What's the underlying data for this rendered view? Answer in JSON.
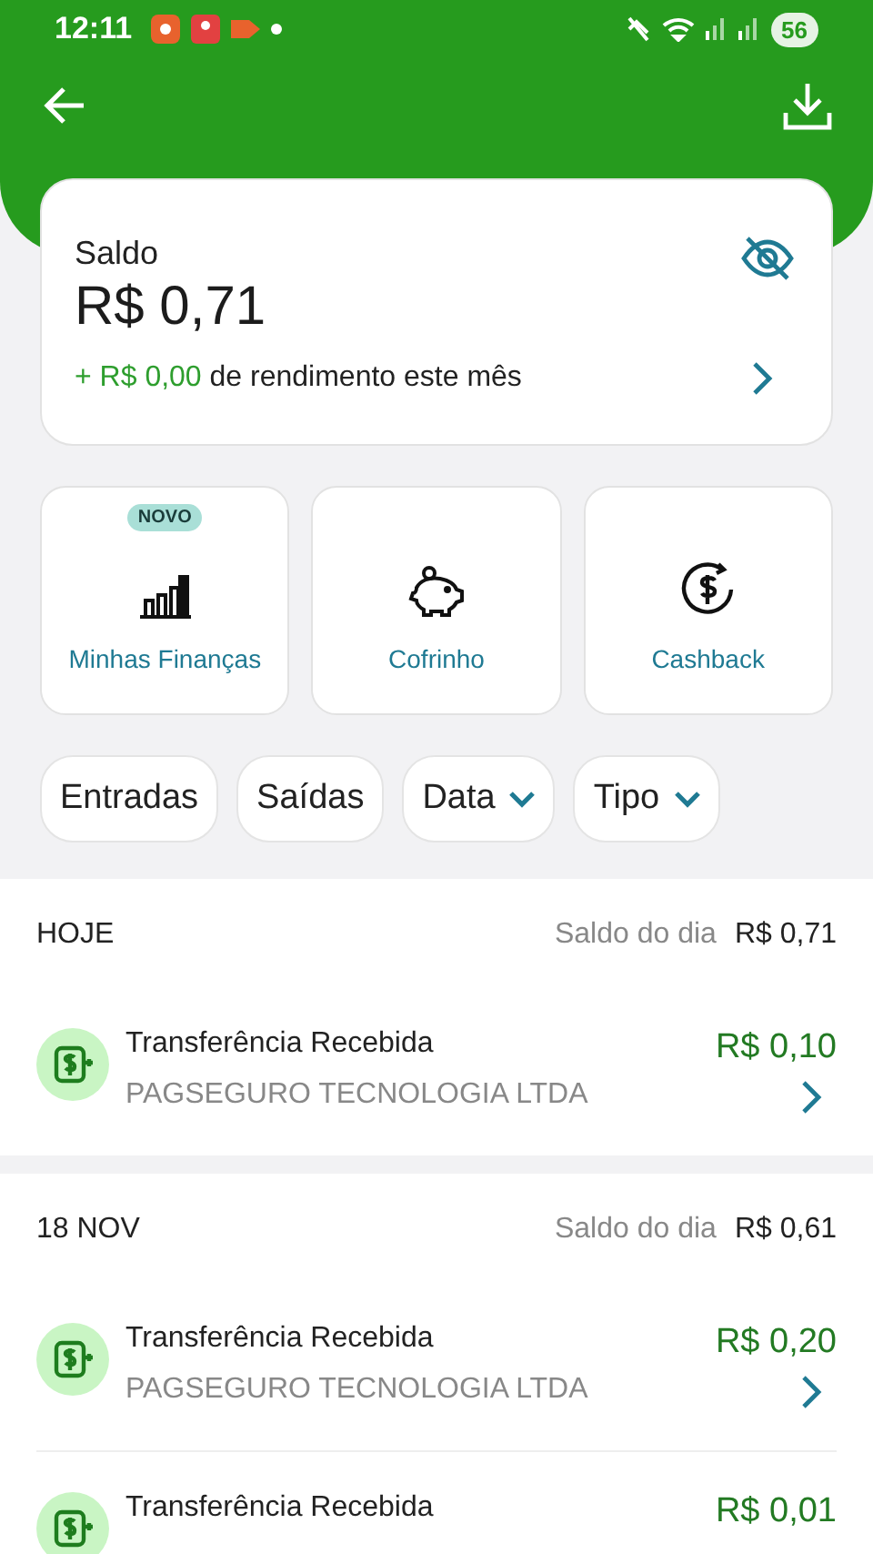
{
  "status_bar": {
    "time": "12:11",
    "battery": "56"
  },
  "balance": {
    "label": "Saldo",
    "amount": "R$ 0,71",
    "yield_amount": "+ R$ 0,00",
    "yield_text": "de rendimento este mês",
    "hidden": false
  },
  "shortcuts": [
    {
      "kind": "chart",
      "label": "Minhas Finanças",
      "badge": "NOVO"
    },
    {
      "kind": "piggy",
      "label": "Cofrinho"
    },
    {
      "kind": "cashback",
      "label": "Cashback"
    }
  ],
  "filters": [
    {
      "kind": "plain",
      "label": "Entradas"
    },
    {
      "kind": "plain",
      "label": "Saídas"
    },
    {
      "kind": "dropdown",
      "label": "Data"
    },
    {
      "kind": "dropdown",
      "label": "Tipo"
    }
  ],
  "days": [
    {
      "date": "HOJE",
      "balance_label": "Saldo do dia",
      "balance": "R$ 0,71",
      "transactions": [
        {
          "title": "Transferência Recebida",
          "subtitle": "PAGSEGURO TECNOLOGIA LTDA",
          "amount": "R$ 0,10"
        }
      ]
    },
    {
      "date": "18 NOV",
      "balance_label": "Saldo do dia",
      "balance": "R$ 0,61",
      "transactions": [
        {
          "title": "Transferência Recebida",
          "subtitle": "PAGSEGURO TECNOLOGIA LTDA",
          "amount": "R$ 0,20"
        },
        {
          "title": "Transferência Recebida",
          "amount": "R$ 0,01"
        }
      ]
    }
  ]
}
